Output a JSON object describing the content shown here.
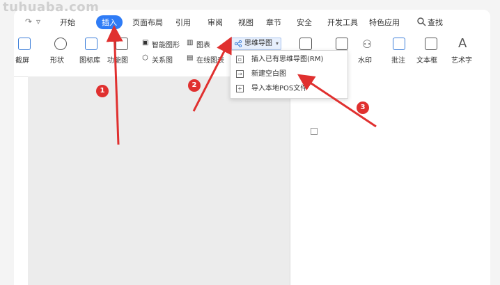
{
  "watermark": "tuhuaba.com",
  "quick_access": {
    "redo_icon": "redo-icon",
    "more_icon": "chevron-down-icon"
  },
  "tabs": [
    {
      "label": "开始"
    },
    {
      "label": "插入",
      "active": true
    },
    {
      "label": "页面布局"
    },
    {
      "label": "引用"
    },
    {
      "label": "审阅"
    },
    {
      "label": "视图"
    },
    {
      "label": "章节"
    },
    {
      "label": "安全"
    },
    {
      "label": "开发工具"
    },
    {
      "label": "特色应用"
    },
    {
      "label": "查找"
    }
  ],
  "ribbon": {
    "screenshot": "截屏",
    "shape": "形状",
    "icon_lib": "图标库",
    "func_diagram": "功能图",
    "smart_graphic": "智能图形",
    "chart": "图表",
    "mind_map": "思维导图",
    "relation_graph": "关系图",
    "online_chart": "在线图表",
    "watermark": "水印",
    "comment": "批注",
    "textbox": "文本框",
    "art_text": "艺术字"
  },
  "mindmap_menu": [
    {
      "label": "插入已有思维导图(RM)",
      "icon": "insert-mindmap-icon"
    },
    {
      "label": "新建空白图",
      "icon": "new-blank-icon"
    },
    {
      "label": "导入本地POS文件",
      "icon": "import-icon"
    }
  ],
  "annotations": {
    "step1": "1",
    "step2": "2",
    "step3": "3",
    "arrow_color": "#e0302f"
  },
  "colors": {
    "accent": "#2f7cf6",
    "marker": "#e0302f"
  }
}
